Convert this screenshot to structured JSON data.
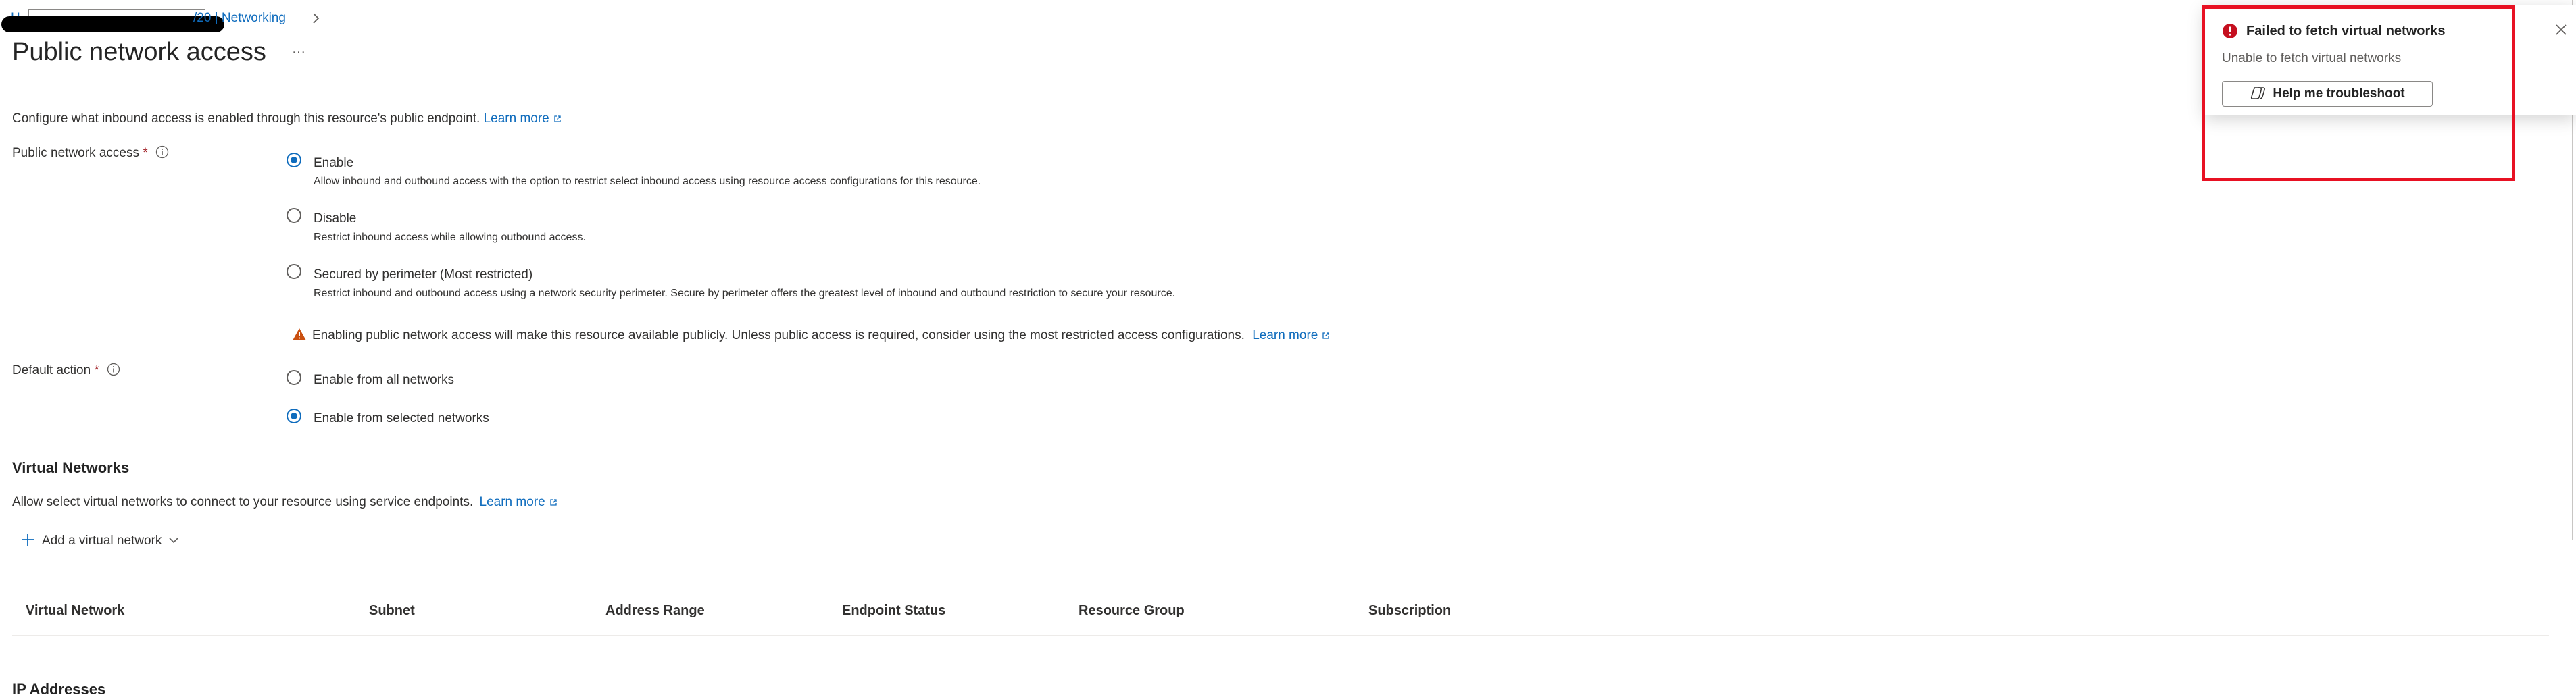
{
  "breadcrumb": {
    "home": "H",
    "resource": "/20 | Networking",
    "separator_icon": "chevron-right-icon"
  },
  "page": {
    "title": "Public network access",
    "more_label": "···"
  },
  "intro": {
    "text": "Configure what inbound access is enabled through this resource's public endpoint.",
    "learn_more": "Learn more"
  },
  "public_access": {
    "label": "Public network access",
    "required": "*",
    "options": [
      {
        "title": "Enable",
        "desc": "Allow inbound and outbound access with the option to restrict select inbound access using resource access configurations for this resource.",
        "checked": true
      },
      {
        "title": "Disable",
        "desc": "Restrict inbound access while allowing outbound access.",
        "checked": false
      },
      {
        "title": "Secured by perimeter (Most restricted)",
        "desc": "Restrict inbound and outbound access using a network security perimeter. Secure by perimeter offers the greatest level of inbound and outbound restriction to secure your resource.",
        "checked": false
      }
    ],
    "warning": "Enabling public network access will make this resource available publicly. Unless public access is required, consider using the most restricted access configurations.",
    "warning_link": "Learn more"
  },
  "default_action": {
    "label": "Default action",
    "required": "*",
    "options": [
      {
        "title": "Enable from all networks",
        "checked": false
      },
      {
        "title": "Enable from selected networks",
        "checked": true
      }
    ]
  },
  "virtual_networks": {
    "heading": "Virtual Networks",
    "desc": "Allow select virtual networks to connect to your resource using service endpoints.",
    "learn_more": "Learn more",
    "add_label": "Add a virtual network",
    "columns": [
      "Virtual Network",
      "Subnet",
      "Address Range",
      "Endpoint Status",
      "Resource Group",
      "Subscription"
    ]
  },
  "ip_addresses": {
    "heading": "IP Addresses"
  },
  "notification": {
    "title": "Failed to fetch virtual networks",
    "message": "Unable to fetch virtual networks",
    "button": "Help me troubleshoot",
    "highlight_color": "#e81123",
    "error_color": "#c50f1f"
  }
}
